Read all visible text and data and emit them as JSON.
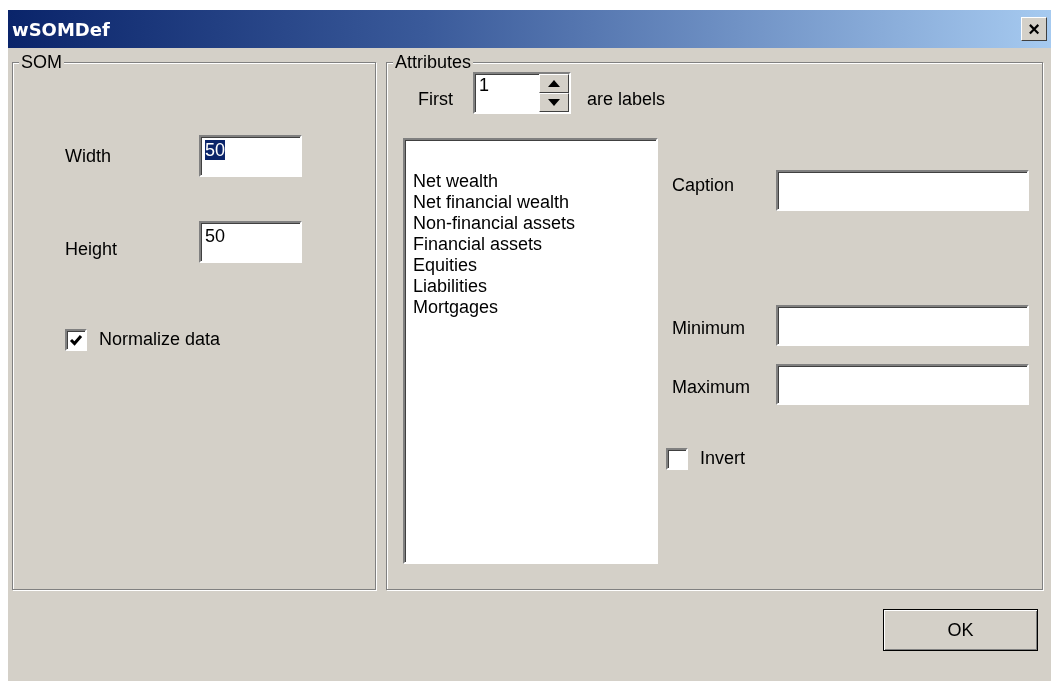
{
  "window": {
    "title": "wSOMDef",
    "close_button": "×"
  },
  "som": {
    "title": "SOM",
    "fields": [
      {
        "label": "Width",
        "value": "50",
        "selected": true
      },
      {
        "label": "Height",
        "value": "50",
        "selected": false
      }
    ],
    "normalize": {
      "label": "Normalize data",
      "checked": true
    }
  },
  "attributes": {
    "title": "Attributes",
    "first": {
      "label_before": "First",
      "value": "1",
      "label_after": "are labels"
    },
    "list_items": [
      "Net wealth",
      "Net financial wealth",
      "Non-financial assets",
      "Financial assets",
      "Equities",
      "Liabilities",
      "Mortgages"
    ],
    "fields": [
      {
        "label": "Caption"
      },
      {
        "label": "Minimum"
      },
      {
        "label": "Maximum"
      }
    ],
    "invert": {
      "label": "Invert",
      "checked": false
    }
  },
  "buttons": [
    {
      "label": "OK"
    }
  ]
}
